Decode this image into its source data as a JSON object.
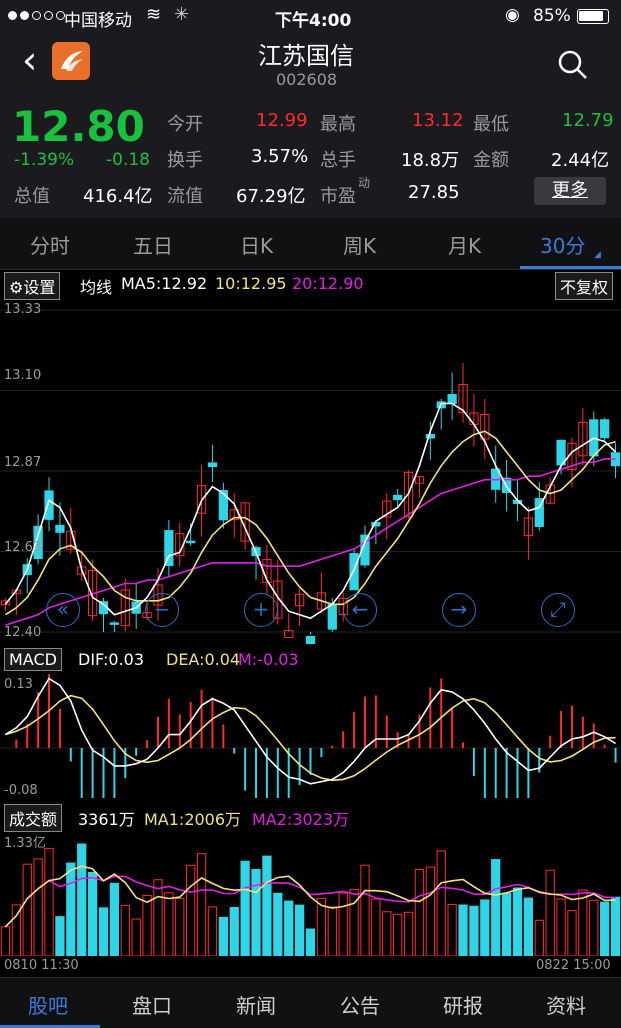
{
  "status": {
    "carrier": "中国移动",
    "time": "下午4:00",
    "battery": "85%"
  },
  "header": {
    "title": "江苏国信",
    "code": "002608"
  },
  "quote": {
    "price": "12.80",
    "change_pct": "-1.39%",
    "change": "-0.18",
    "open_label": "今开",
    "open": "12.99",
    "high_label": "最高",
    "high": "13.12",
    "low_label": "最低",
    "low": "12.79",
    "turnover_label": "换手",
    "turnover": "3.57%",
    "volume_label": "总手",
    "volume": "18.8万",
    "amount_label": "金额",
    "amount": "2.44亿",
    "mcap_label": "总值",
    "mcap": "416.4亿",
    "float_label": "流值",
    "float": "67.29亿",
    "pe_label": "市盈",
    "pe_sup": "动",
    "pe": "27.85",
    "more_label": "更多"
  },
  "tabs": [
    "分时",
    "五日",
    "日K",
    "周K",
    "月K",
    "30分"
  ],
  "kline": {
    "settings_label": "设置",
    "ma_label": "均线",
    "ma5": "MA5:12.92",
    "ma10": "10:12.95",
    "ma20": "20:12.90",
    "adjust_label": "不复权",
    "y_ticks": [
      "13.33",
      "13.10",
      "12.87",
      "12.63",
      "12.40"
    ]
  },
  "macd": {
    "label": "MACD",
    "dif": "DIF:0.03",
    "dea": "DEA:0.04",
    "m": "M:-0.03",
    "y_top": "0.13",
    "y_bottom": "-0.08"
  },
  "volume_panel": {
    "label": "成交额",
    "value": "3361万",
    "ma1": "MA1:2006万",
    "ma2": "MA2:3023万",
    "y_top": "1.33亿",
    "x_start": "0810 11:30",
    "x_end": "0822 15:00"
  },
  "bottom_nav": [
    "股吧",
    "盘口",
    "新闻",
    "公告",
    "研报",
    "资料"
  ],
  "colors": {
    "up": "#ff2a2a",
    "down": "#2fd4e6",
    "ma5": "#ffffff",
    "ma10": "#f2e27a",
    "ma20": "#e020e0",
    "accent": "#3b7bd8"
  },
  "chart_data": {
    "type": "candlestick",
    "ylim": [
      12.4,
      13.33
    ],
    "ma5": [
      12.48,
      12.52,
      12.58,
      12.68,
      12.78,
      12.76,
      12.7,
      12.58,
      12.5,
      12.48,
      12.45,
      12.46,
      12.47,
      12.5,
      12.55,
      12.62,
      12.63,
      12.7,
      12.78,
      12.82,
      12.8,
      12.77,
      12.7,
      12.63,
      12.55,
      12.5,
      12.46,
      12.45,
      12.44,
      12.46,
      12.48,
      12.52,
      12.58,
      12.66,
      12.72,
      12.74,
      12.76,
      12.8,
      12.88,
      12.98,
      13.06,
      13.06,
      13.04,
      13.0,
      12.95,
      12.88,
      12.82,
      12.78,
      12.75,
      12.76,
      12.82,
      12.88,
      12.92,
      12.94,
      12.96,
      12.95,
      12.92
    ],
    "ma10": [
      12.45,
      12.47,
      12.5,
      12.55,
      12.61,
      12.64,
      12.65,
      12.63,
      12.59,
      12.56,
      12.52,
      12.5,
      12.49,
      12.49,
      12.49,
      12.5,
      12.53,
      12.57,
      12.63,
      12.68,
      12.71,
      12.73,
      12.73,
      12.71,
      12.67,
      12.62,
      12.57,
      12.53,
      12.5,
      12.49,
      12.48,
      12.48,
      12.5,
      12.54,
      12.59,
      12.63,
      12.67,
      12.72,
      12.77,
      12.83,
      12.88,
      12.92,
      12.95,
      12.97,
      12.98,
      12.96,
      12.92,
      12.88,
      12.84,
      12.81,
      12.8,
      12.81,
      12.84,
      12.87,
      12.91,
      12.94,
      12.95
    ],
    "ma20": [
      12.42,
      12.43,
      12.44,
      12.45,
      12.47,
      12.48,
      12.49,
      12.5,
      12.51,
      12.52,
      12.53,
      12.54,
      12.54,
      12.55,
      12.55,
      12.56,
      12.57,
      12.58,
      12.59,
      12.6,
      12.6,
      12.6,
      12.6,
      12.6,
      12.59,
      12.59,
      12.59,
      12.59,
      12.6,
      12.61,
      12.62,
      12.63,
      12.64,
      12.66,
      12.68,
      12.7,
      12.72,
      12.74,
      12.76,
      12.78,
      12.8,
      12.81,
      12.82,
      12.83,
      12.84,
      12.84,
      12.84,
      12.84,
      12.85,
      12.85,
      12.86,
      12.87,
      12.88,
      12.89,
      12.89,
      12.9,
      12.9
    ]
  }
}
